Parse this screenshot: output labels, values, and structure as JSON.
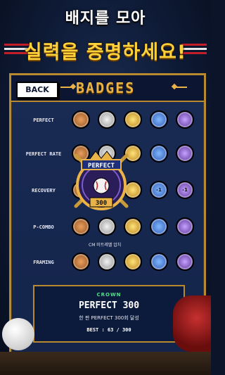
{
  "header": {
    "line1": "배지를 모아",
    "line2": "실력을 증명하세요!"
  },
  "panel": {
    "back_label": "BACK",
    "title": "BADGES"
  },
  "rows": [
    {
      "label": "PERFECT",
      "badges": [
        "",
        "",
        "",
        "",
        "",
        ""
      ]
    },
    {
      "label": "PERFECT RATE",
      "badges": [
        "",
        "",
        "",
        "",
        "",
        ""
      ]
    },
    {
      "label": "RECOVERY",
      "badges": [
        "",
        "",
        "",
        "",
        "-1",
        "-1"
      ]
    },
    {
      "label": "P-COMBO",
      "badges": [
        "",
        "",
        "",
        "",
        "",
        ""
      ]
    },
    {
      "label": "FRAMING",
      "badges": [
        "",
        "",
        "",
        "",
        "",
        ""
      ]
    }
  ],
  "tooltip": "CM 미트레벨 압치",
  "featured": {
    "name": "PERFECT",
    "number": "300"
  },
  "info": {
    "kind": "CROWN",
    "name": "PERFECT 300",
    "desc": "한 판 PERFECT 300회 달성",
    "best": "BEST : 63 / 300"
  },
  "colors": {
    "gold": "#e9b347",
    "bg": "#13244a",
    "green": "#53e08a"
  }
}
